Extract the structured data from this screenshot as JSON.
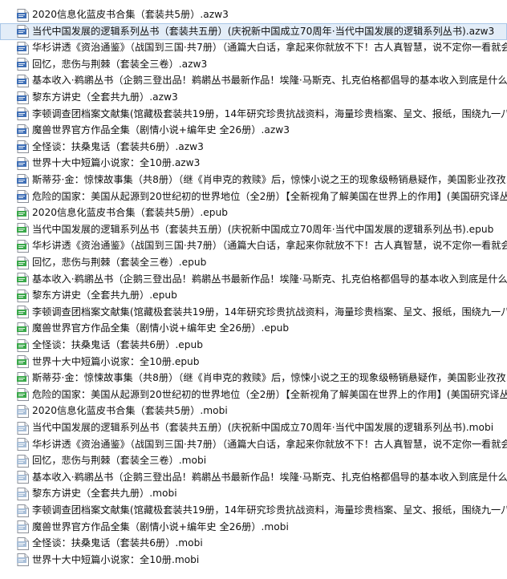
{
  "file_list": {
    "selected_index": 1,
    "icon_colors": {
      "azw": "#3f6fb6",
      "epub": "#3aa84a",
      "mobi": "#a9bfd8"
    },
    "items": [
      {
        "name": "2020信息化蓝皮书合集（套装共5册）.azw3",
        "type": "azw",
        "icon": "azw-file-icon"
      },
      {
        "name": "当代中国发展的逻辑系列丛书（套装共五册）(庆祝新中国成立70周年·当代中国发展的逻辑系列丛书).azw3",
        "type": "azw",
        "icon": "azw-file-icon"
      },
      {
        "name": "华杉讲透《资治通鉴》（战国到三国·共7册）（通篇大白话，拿起来你就放不下！古人真智慧，说不定你一看就会",
        "type": "azw",
        "icon": "azw-file-icon"
      },
      {
        "name": "回忆，悲伤与荆棘（套装全三卷）.azw3",
        "type": "azw",
        "icon": "azw-file-icon"
      },
      {
        "name": "基本收入·鹈鹕丛书（企鹅三登出品！鹈鹕丛书最新作品！埃隆·马斯克、扎克伯格都倡导的基本收入到底是什么？",
        "type": "azw",
        "icon": "azw-file-icon"
      },
      {
        "name": "黎东方讲史（全套共九册）.azw3",
        "type": "azw",
        "icon": "azw-file-icon"
      },
      {
        "name": "李顿调查团档案文献集(馆藏极套装共19册，14年研究珍贵抗战资料，海量珍贵档案、呈文、报纸，围绕九一八事",
        "type": "azw",
        "icon": "azw-file-icon"
      },
      {
        "name": "魔兽世界官方作品全集（剧情小说+编年史 全26册）.azw3",
        "type": "azw",
        "icon": "azw-file-icon"
      },
      {
        "name": "全怪谈：扶桑鬼话（套装共6册）.azw3",
        "type": "azw",
        "icon": "azw-file-icon"
      },
      {
        "name": "世界十大中短篇小说家：全10册.azw3",
        "type": "azw",
        "icon": "azw-file-icon"
      },
      {
        "name": "斯蒂芬·金：惊悚故事集（共8册）（继《肖申克的救赎》后，惊悚小说之王的现象级畅销悬疑作，美国影业孜孜以",
        "type": "azw",
        "icon": "azw-file-icon"
      },
      {
        "name": "危险的国家：美国从起源到20世纪初的世界地位（全2册）【全新视角了解美国在世界上的作用】(美国研究译丛",
        "type": "azw",
        "icon": "azw-file-icon"
      },
      {
        "name": "2020信息化蓝皮书合集（套装共5册）.epub",
        "type": "epub",
        "icon": "epub-file-icon"
      },
      {
        "name": "当代中国发展的逻辑系列丛书（套装共五册）(庆祝新中国成立70周年·当代中国发展的逻辑系列丛书).epub",
        "type": "epub",
        "icon": "epub-file-icon"
      },
      {
        "name": "华杉讲透《资治通鉴》（战国到三国·共7册）（通篇大白话，拿起来你就放不下！古人真智慧，说不定你一看就会",
        "type": "epub",
        "icon": "epub-file-icon"
      },
      {
        "name": "回忆，悲伤与荆棘（套装全三卷）.epub",
        "type": "epub",
        "icon": "epub-file-icon"
      },
      {
        "name": "基本收入·鹈鹕丛书（企鹅三登出品！鹈鹕丛书最新作品！埃隆·马斯克、扎克伯格都倡导的基本收入到底是什么？",
        "type": "epub",
        "icon": "epub-file-icon"
      },
      {
        "name": "黎东方讲史（全套共九册）.epub",
        "type": "epub",
        "icon": "epub-file-icon"
      },
      {
        "name": "李顿调查团档案文献集(馆藏极套装共19册，14年研究珍贵抗战资料，海量珍贵档案、呈文、报纸，围绕九一八事",
        "type": "epub",
        "icon": "epub-file-icon"
      },
      {
        "name": "魔兽世界官方作品全集（剧情小说+编年史 全26册）.epub",
        "type": "epub",
        "icon": "epub-file-icon"
      },
      {
        "name": "全怪谈：扶桑鬼话（套装共6册）.epub",
        "type": "epub",
        "icon": "epub-file-icon"
      },
      {
        "name": "世界十大中短篇小说家：全10册.epub",
        "type": "epub",
        "icon": "epub-file-icon"
      },
      {
        "name": "斯蒂芬·金：惊悚故事集（共8册）（继《肖申克的救赎》后，惊悚小说之王的现象级畅销悬疑作，美国影业孜孜以",
        "type": "epub",
        "icon": "epub-file-icon"
      },
      {
        "name": "危险的国家：美国从起源到20世纪初的世界地位（全2册）【全新视角了解美国在世界上的作用】(美国研究译丛",
        "type": "epub",
        "icon": "epub-file-icon"
      },
      {
        "name": "2020信息化蓝皮书合集（套装共5册）.mobi",
        "type": "mobi",
        "icon": "mobi-file-icon"
      },
      {
        "name": "当代中国发展的逻辑系列丛书（套装共五册）(庆祝新中国成立70周年·当代中国发展的逻辑系列丛书).mobi",
        "type": "mobi",
        "icon": "mobi-file-icon"
      },
      {
        "name": "华杉讲透《资治通鉴》（战国到三国·共7册）（通篇大白话，拿起来你就放不下！古人真智慧，说不定你一看就会",
        "type": "mobi",
        "icon": "mobi-file-icon"
      },
      {
        "name": "回忆，悲伤与荆棘（套装全三卷）.mobi",
        "type": "mobi",
        "icon": "mobi-file-icon"
      },
      {
        "name": "基本收入·鹈鹕丛书（企鹅三登出品！鹈鹕丛书最新作品！埃隆·马斯克、扎克伯格都倡导的基本收入到底是什么？",
        "type": "mobi",
        "icon": "mobi-file-icon"
      },
      {
        "name": "黎东方讲史（全套共九册）.mobi",
        "type": "mobi",
        "icon": "mobi-file-icon"
      },
      {
        "name": "李顿调查团档案文献集(馆藏极套装共19册，14年研究珍贵抗战资料，海量珍贵档案、呈文、报纸，围绕九一八事",
        "type": "mobi",
        "icon": "mobi-file-icon"
      },
      {
        "name": "魔兽世界官方作品全集（剧情小说+编年史 全26册）.mobi",
        "type": "mobi",
        "icon": "mobi-file-icon"
      },
      {
        "name": "全怪谈：扶桑鬼话（套装共6册）.mobi",
        "type": "mobi",
        "icon": "mobi-file-icon"
      },
      {
        "name": "世界十大中短篇小说家：全10册.mobi",
        "type": "mobi",
        "icon": "mobi-file-icon"
      }
    ]
  }
}
